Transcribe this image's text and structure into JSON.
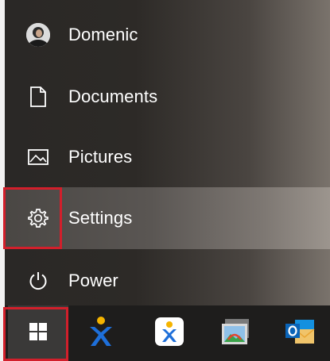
{
  "start_menu": {
    "items": [
      {
        "label": "Domenic",
        "icon": "user-avatar-icon"
      },
      {
        "label": "Documents",
        "icon": "document-icon"
      },
      {
        "label": "Pictures",
        "icon": "pictures-icon"
      },
      {
        "label": "Settings",
        "icon": "gear-icon"
      },
      {
        "label": "Power",
        "icon": "power-icon"
      }
    ]
  },
  "taskbar": {
    "apps": [
      {
        "icon": "windows-start-icon"
      },
      {
        "icon": "xpeditor-app-icon"
      },
      {
        "icon": "xchange-app-icon"
      },
      {
        "icon": "image-viewer-app-icon"
      },
      {
        "icon": "outlook-app-icon"
      }
    ]
  },
  "colors": {
    "highlight": "#d21f2b",
    "text": "#ffffff"
  }
}
